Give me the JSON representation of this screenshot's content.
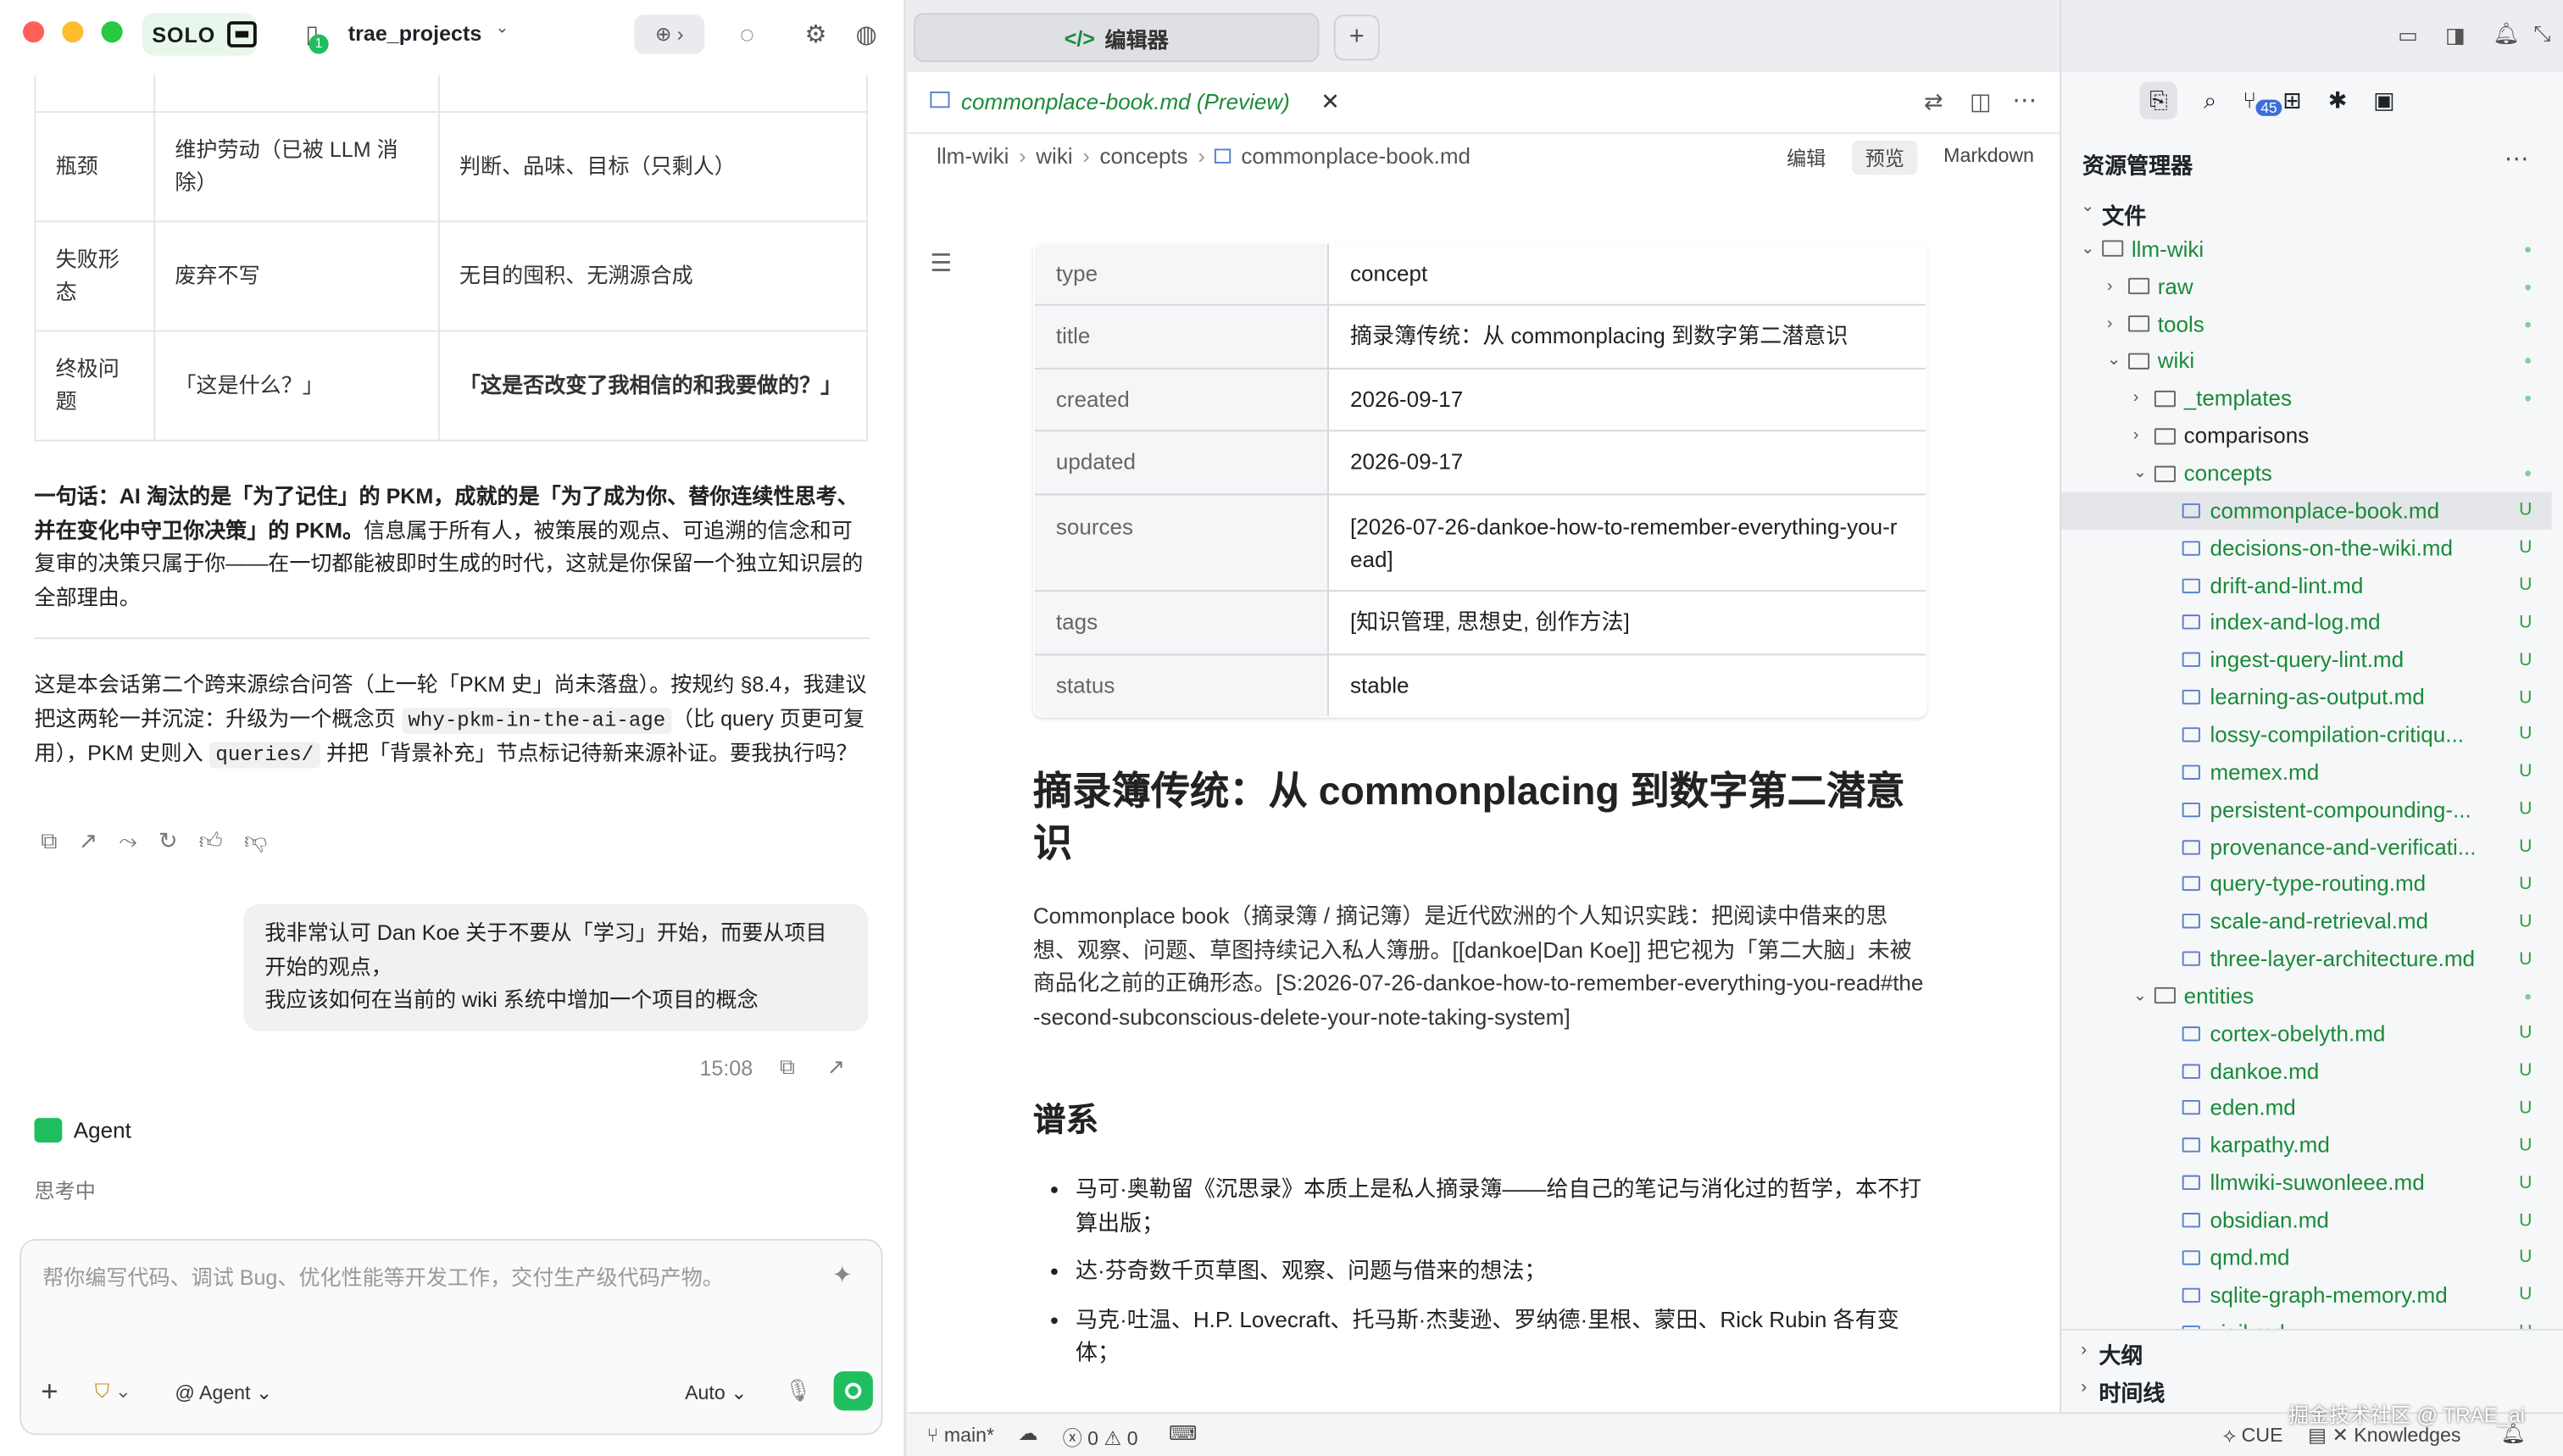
{
  "app": {
    "solo": "SOLO",
    "project": "trae_projects",
    "project_badge": "1"
  },
  "chat": {
    "table_rows": [
      {
        "c1": "瓶颈",
        "c2": "维护劳动（已被 LLM 消除）",
        "c3": "判断、品味、目标（只剩人）"
      },
      {
        "c1": "失败形态",
        "c2": "废弃不写",
        "c3": "无目的囤积、无溯源合成"
      },
      {
        "c1": "终极问题",
        "c2": "「这是什么？」",
        "c3": "「这是否改变了我相信的和我要做的？」"
      }
    ],
    "summary_bold": "一句话：AI 淘汰的是「为了记住」的 PKM，成就的是「为了成为你、替你连续性思考、并在变化中守卫你决策」的 PKM。",
    "summary_rest": "信息属于所有人，被策展的观点、可追溯的信念和可复审的决策只属于你——在一切都能被即时生成的时代，这就是你保留一个独立知识层的全部理由。",
    "p2_a": "这是本会话第二个跨来源综合问答（上一轮「PKM 史」尚未落盘）。按规约 §8.4，我建议把这两轮一并沉淀：升级为一个概念页 ",
    "p2_code1": "why-pkm-in-the-ai-age",
    "p2_b": "（比 query 页更可复用），PKM 史则入 ",
    "p2_code2": "queries/",
    "p2_c": " 并把「背景补充」节点标记待新来源补证。要我执行吗？",
    "user_l1": "我非常认可 Dan Koe 关于不要从「学习」开始，而要从项目开始的观点，",
    "user_l2": "我应该如何在当前的 wiki 系统中增加一个项目的概念",
    "time": "15:08",
    "agent_name": "Agent",
    "thinking": "思考中"
  },
  "composer": {
    "placeholder": "帮你编写代码、调试 Bug、优化性能等开发工作，交付生产级代码产物。",
    "agent_label": "@ Agent",
    "model": "Auto"
  },
  "editor": {
    "tab_label": "编辑器",
    "file_tab": "commonplace-book.md (Preview)",
    "breadcrumbs": [
      "llm-wiki",
      "wiki",
      "concepts",
      "commonplace-book.md"
    ],
    "modes": [
      "编辑",
      "预览",
      "Markdown"
    ],
    "frontmatter": [
      {
        "k": "type",
        "v": "concept"
      },
      {
        "k": "title",
        "v": "摘录簿传统：从 commonplacing 到数字第二潜意识"
      },
      {
        "k": "created",
        "v": "2026-09-17"
      },
      {
        "k": "updated",
        "v": "2026-09-17"
      },
      {
        "k": "sources",
        "v": "[2026-07-26-dankoe-how-to-remember-everything-you-read]"
      },
      {
        "k": "tags",
        "v": "[知识管理, 思想史, 创作方法]"
      },
      {
        "k": "status",
        "v": "stable"
      }
    ],
    "h1": "摘录簿传统：从 commonplacing 到数字第二潜意识",
    "para": "Commonplace book（摘录簿 / 摘记簿）是近代欧洲的个人知识实践：把阅读中借来的思想、观察、问题、草图持续记入私人簿册。[[dankoe|Dan Koe]] 把它视为「第二大脑」未被商品化之前的正确形态。[S:2026-07-26-dankoe-how-to-remember-everything-you-read#the-second-subconscious-delete-your-note-taking-system]",
    "h2": "谱系",
    "bullets": [
      "马可·奥勒留《沉思录》本质上是私人摘录簿——给自己的笔记与消化过的哲学，本不打算出版；",
      "达·芬奇数千页草图、观察、问题与借来的想法；",
      "马克·吐温、H.P. Lovecraft、托马斯·杰斐逊、罗纳德·里根、蒙田、Rick Rubin 各有变体；"
    ]
  },
  "status_bar": {
    "branch": "main*",
    "errors": "0",
    "warnings": "0",
    "cue": "CUE",
    "knowledges": "Knowledges",
    "watermark": "掘金技术社区 @ TRAE_ai"
  },
  "explorer": {
    "title": "资源管理器",
    "files_label": "文件",
    "badge": "45",
    "outline": "大纲",
    "timeline": "时间线",
    "tree": [
      {
        "name": "llm-wiki",
        "type": "folder",
        "depth": 0,
        "open": true,
        "status": "dot",
        "green": true
      },
      {
        "name": "raw",
        "type": "folder",
        "depth": 1,
        "open": false,
        "status": "dot",
        "green": true
      },
      {
        "name": "tools",
        "type": "folder",
        "depth": 1,
        "open": false,
        "status": "dot",
        "green": true
      },
      {
        "name": "wiki",
        "type": "folder",
        "depth": 1,
        "open": true,
        "status": "dot",
        "green": true
      },
      {
        "name": "_templates",
        "type": "folder",
        "depth": 2,
        "open": false,
        "status": "dot",
        "green": true
      },
      {
        "name": "comparisons",
        "type": "folder",
        "depth": 2,
        "open": false,
        "status": "",
        "green": false
      },
      {
        "name": "concepts",
        "type": "folder",
        "depth": 2,
        "open": true,
        "status": "dot",
        "green": true
      },
      {
        "name": "commonplace-book.md",
        "type": "file",
        "depth": 3,
        "status": "U",
        "green": true,
        "selected": true
      },
      {
        "name": "decisions-on-the-wiki.md",
        "type": "file",
        "depth": 3,
        "status": "U",
        "green": true
      },
      {
        "name": "drift-and-lint.md",
        "type": "file",
        "depth": 3,
        "status": "U",
        "green": true
      },
      {
        "name": "index-and-log.md",
        "type": "file",
        "depth": 3,
        "status": "U",
        "green": true
      },
      {
        "name": "ingest-query-lint.md",
        "type": "file",
        "depth": 3,
        "status": "U",
        "green": true
      },
      {
        "name": "learning-as-output.md",
        "type": "file",
        "depth": 3,
        "status": "U",
        "green": true
      },
      {
        "name": "lossy-compilation-critiqu...",
        "type": "file",
        "depth": 3,
        "status": "U",
        "green": true
      },
      {
        "name": "memex.md",
        "type": "file",
        "depth": 3,
        "status": "U",
        "green": true
      },
      {
        "name": "persistent-compounding-...",
        "type": "file",
        "depth": 3,
        "status": "U",
        "green": true
      },
      {
        "name": "provenance-and-verificati...",
        "type": "file",
        "depth": 3,
        "status": "U",
        "green": true
      },
      {
        "name": "query-type-routing.md",
        "type": "file",
        "depth": 3,
        "status": "U",
        "green": true
      },
      {
        "name": "scale-and-retrieval.md",
        "type": "file",
        "depth": 3,
        "status": "U",
        "green": true
      },
      {
        "name": "three-layer-architecture.md",
        "type": "file",
        "depth": 3,
        "status": "U",
        "green": true
      },
      {
        "name": "entities",
        "type": "folder",
        "depth": 2,
        "open": true,
        "status": "dot",
        "green": true
      },
      {
        "name": "cortex-obelyth.md",
        "type": "file",
        "depth": 3,
        "status": "U",
        "green": true
      },
      {
        "name": "dankoe.md",
        "type": "file",
        "depth": 3,
        "status": "U",
        "green": true
      },
      {
        "name": "eden.md",
        "type": "file",
        "depth": 3,
        "status": "U",
        "green": true
      },
      {
        "name": "karpathy.md",
        "type": "file",
        "depth": 3,
        "status": "U",
        "green": true
      },
      {
        "name": "llmwiki-suwonleee.md",
        "type": "file",
        "depth": 3,
        "status": "U",
        "green": true
      },
      {
        "name": "obsidian.md",
        "type": "file",
        "depth": 3,
        "status": "U",
        "green": true
      },
      {
        "name": "qmd.md",
        "type": "file",
        "depth": 3,
        "status": "U",
        "green": true
      },
      {
        "name": "sqlite-graph-memory.md",
        "type": "file",
        "depth": 3,
        "status": "U",
        "green": true
      },
      {
        "name": "vigil.md",
        "type": "file",
        "depth": 3,
        "status": "U",
        "green": true
      }
    ]
  },
  "colors": {
    "accent_green": "#1a8a3a",
    "solo_bg": "#e8f7ec",
    "send_green": "#1fbf5f"
  }
}
